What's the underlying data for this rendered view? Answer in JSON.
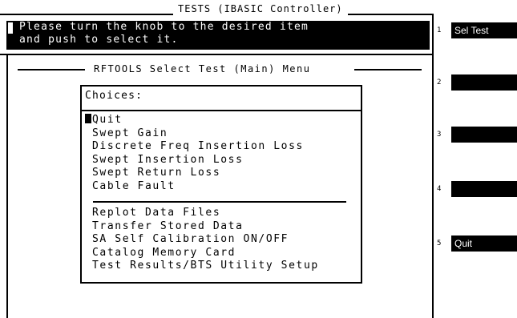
{
  "window": {
    "title": "TESTS (IBASIC Controller)"
  },
  "prompt": {
    "line1": "Please turn the knob to the desired item",
    "line2": "and push to select it."
  },
  "menu": {
    "title": "RFTOOLS Select Test (Main) Menu",
    "choices_label": "Choices:",
    "selected_index": 0,
    "group1": [
      "Quit",
      "Swept Gain",
      "Discrete Freq Insertion Loss",
      "Swept Insertion Loss",
      "Swept Return Loss",
      "Cable Fault"
    ],
    "group2": [
      "Replot Data Files",
      "Transfer Stored Data",
      "SA Self Calibration ON/OFF",
      "Catalog Memory Card",
      "Test Results/BTS Utility Setup"
    ]
  },
  "softkeys": [
    {
      "num": "1",
      "label": "Sel Test"
    },
    {
      "num": "2",
      "label": ""
    },
    {
      "num": "3",
      "label": ""
    },
    {
      "num": "4",
      "label": ""
    },
    {
      "num": "5",
      "label": "Quit"
    }
  ]
}
